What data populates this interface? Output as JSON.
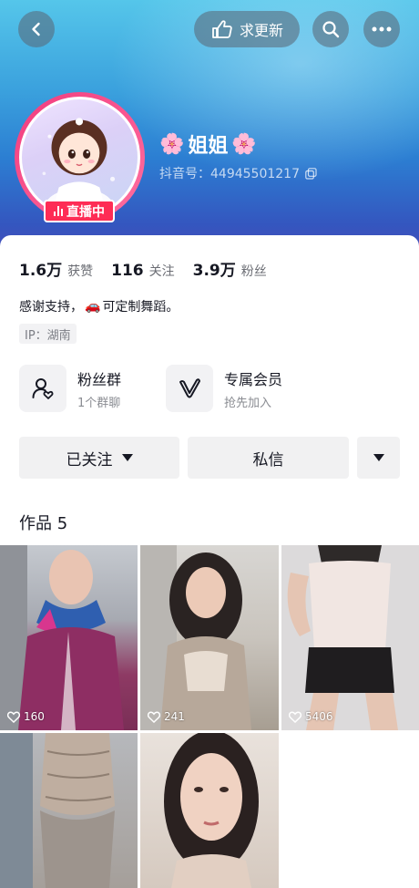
{
  "header": {
    "update_label": "求更新",
    "icons": {
      "back": "back-arrow-icon",
      "update": "hand-pointing-icon",
      "search": "search-icon",
      "more": "more-dots-icon"
    }
  },
  "profile": {
    "nickname": "姐姐",
    "decoration_left": "🌸",
    "decoration_right": "🌸",
    "douyin_id": "抖音号：44945501217",
    "live_badge": "直播中"
  },
  "stats": [
    {
      "num": "1.6万",
      "label": "获赞"
    },
    {
      "num": "116",
      "label": "关注"
    },
    {
      "num": "3.9万",
      "label": "粉丝"
    }
  ],
  "bio": {
    "before": "感谢支持，",
    "emoji": "🚗",
    "after": "可定制舞蹈。"
  },
  "ip_label": "IP：湖南",
  "features": [
    {
      "title": "粉丝群",
      "subtitle": "1个群聊",
      "icon": "fan-group-icon"
    },
    {
      "title": "专属会员",
      "subtitle": "抢先加入",
      "icon": "membership-v-icon"
    }
  ],
  "actions": {
    "followed_label": "已关注",
    "message_label": "私信"
  },
  "works": {
    "title": "作品 5",
    "items": [
      {
        "likes": "160"
      },
      {
        "likes": "241"
      },
      {
        "likes": "5406"
      },
      {
        "likes": ""
      },
      {
        "likes": ""
      }
    ]
  },
  "colors": {
    "accent_live": "#fe2c55",
    "avatar_ring": "#f23c7e",
    "banner_top": "#55c6ea",
    "banner_bottom": "#4b4ab8"
  }
}
